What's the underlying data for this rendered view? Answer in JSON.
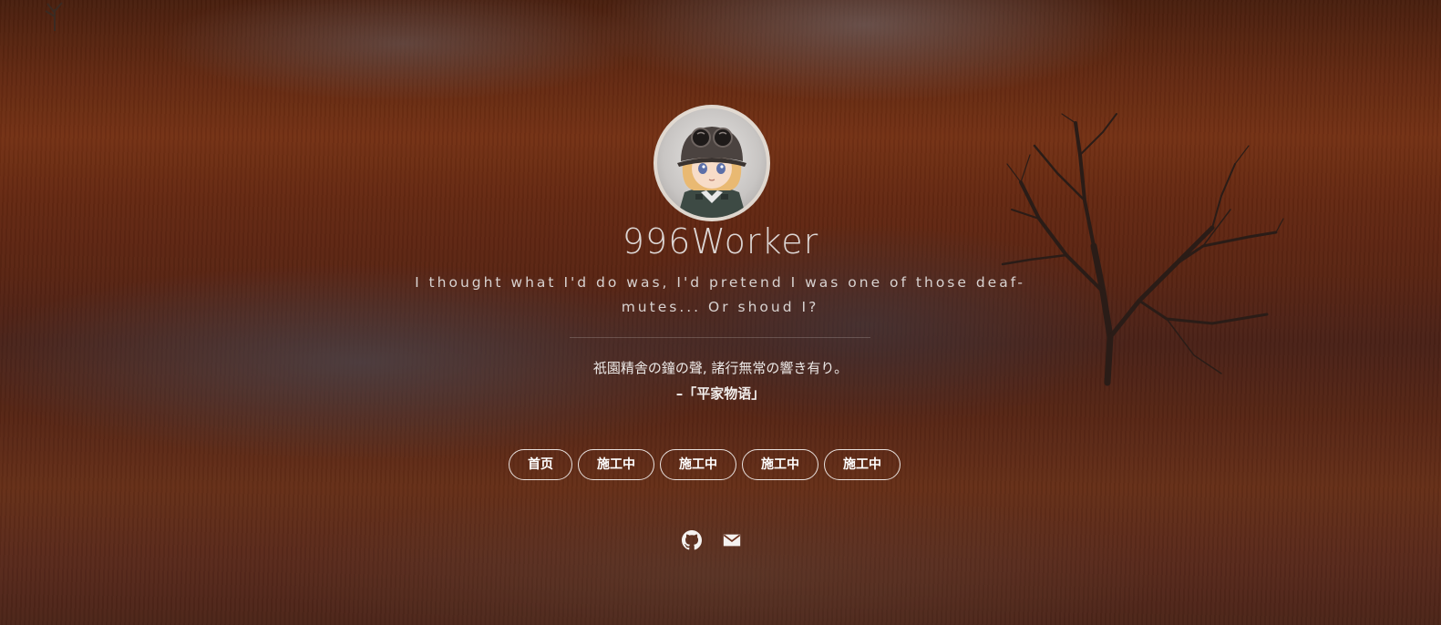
{
  "site": {
    "title": "996Worker",
    "subtitle": "I thought what I'd do was, I'd pretend I was one of those deaf-mutes... Or shoud I?",
    "quote": "祇園精舎の鐘の聲, 諸行無常の響き有り。",
    "quote_source": "–「平家物语」"
  },
  "nav": {
    "items": [
      {
        "label": "首页"
      },
      {
        "label": "施工中"
      },
      {
        "label": "施工中"
      },
      {
        "label": "施工中"
      },
      {
        "label": "施工中"
      }
    ]
  },
  "social": {
    "icons": [
      "github-icon",
      "mail-icon"
    ]
  },
  "colors": {
    "background": "#7a3316",
    "text": "#e9e4e2",
    "nav_border": "#ffffff"
  }
}
